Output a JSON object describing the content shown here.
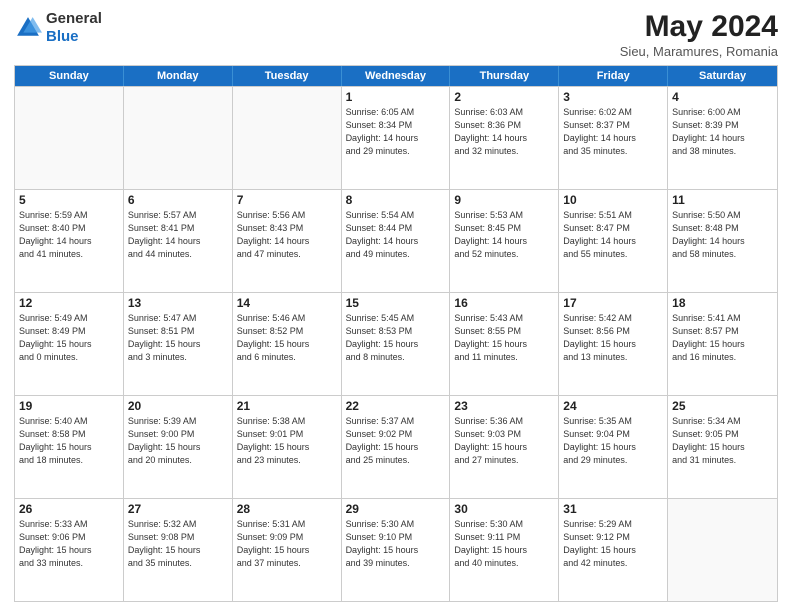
{
  "header": {
    "logo_general": "General",
    "logo_blue": "Blue",
    "title": "May 2024",
    "subtitle": "Sieu, Maramures, Romania"
  },
  "days_of_week": [
    "Sunday",
    "Monday",
    "Tuesday",
    "Wednesday",
    "Thursday",
    "Friday",
    "Saturday"
  ],
  "weeks": [
    [
      {
        "day": "",
        "info": "",
        "empty": true
      },
      {
        "day": "",
        "info": "",
        "empty": true
      },
      {
        "day": "",
        "info": "",
        "empty": true
      },
      {
        "day": "1",
        "info": "Sunrise: 6:05 AM\nSunset: 8:34 PM\nDaylight: 14 hours\nand 29 minutes.",
        "empty": false
      },
      {
        "day": "2",
        "info": "Sunrise: 6:03 AM\nSunset: 8:36 PM\nDaylight: 14 hours\nand 32 minutes.",
        "empty": false
      },
      {
        "day": "3",
        "info": "Sunrise: 6:02 AM\nSunset: 8:37 PM\nDaylight: 14 hours\nand 35 minutes.",
        "empty": false
      },
      {
        "day": "4",
        "info": "Sunrise: 6:00 AM\nSunset: 8:39 PM\nDaylight: 14 hours\nand 38 minutes.",
        "empty": false
      }
    ],
    [
      {
        "day": "5",
        "info": "Sunrise: 5:59 AM\nSunset: 8:40 PM\nDaylight: 14 hours\nand 41 minutes.",
        "empty": false
      },
      {
        "day": "6",
        "info": "Sunrise: 5:57 AM\nSunset: 8:41 PM\nDaylight: 14 hours\nand 44 minutes.",
        "empty": false
      },
      {
        "day": "7",
        "info": "Sunrise: 5:56 AM\nSunset: 8:43 PM\nDaylight: 14 hours\nand 47 minutes.",
        "empty": false
      },
      {
        "day": "8",
        "info": "Sunrise: 5:54 AM\nSunset: 8:44 PM\nDaylight: 14 hours\nand 49 minutes.",
        "empty": false
      },
      {
        "day": "9",
        "info": "Sunrise: 5:53 AM\nSunset: 8:45 PM\nDaylight: 14 hours\nand 52 minutes.",
        "empty": false
      },
      {
        "day": "10",
        "info": "Sunrise: 5:51 AM\nSunset: 8:47 PM\nDaylight: 14 hours\nand 55 minutes.",
        "empty": false
      },
      {
        "day": "11",
        "info": "Sunrise: 5:50 AM\nSunset: 8:48 PM\nDaylight: 14 hours\nand 58 minutes.",
        "empty": false
      }
    ],
    [
      {
        "day": "12",
        "info": "Sunrise: 5:49 AM\nSunset: 8:49 PM\nDaylight: 15 hours\nand 0 minutes.",
        "empty": false
      },
      {
        "day": "13",
        "info": "Sunrise: 5:47 AM\nSunset: 8:51 PM\nDaylight: 15 hours\nand 3 minutes.",
        "empty": false
      },
      {
        "day": "14",
        "info": "Sunrise: 5:46 AM\nSunset: 8:52 PM\nDaylight: 15 hours\nand 6 minutes.",
        "empty": false
      },
      {
        "day": "15",
        "info": "Sunrise: 5:45 AM\nSunset: 8:53 PM\nDaylight: 15 hours\nand 8 minutes.",
        "empty": false
      },
      {
        "day": "16",
        "info": "Sunrise: 5:43 AM\nSunset: 8:55 PM\nDaylight: 15 hours\nand 11 minutes.",
        "empty": false
      },
      {
        "day": "17",
        "info": "Sunrise: 5:42 AM\nSunset: 8:56 PM\nDaylight: 15 hours\nand 13 minutes.",
        "empty": false
      },
      {
        "day": "18",
        "info": "Sunrise: 5:41 AM\nSunset: 8:57 PM\nDaylight: 15 hours\nand 16 minutes.",
        "empty": false
      }
    ],
    [
      {
        "day": "19",
        "info": "Sunrise: 5:40 AM\nSunset: 8:58 PM\nDaylight: 15 hours\nand 18 minutes.",
        "empty": false
      },
      {
        "day": "20",
        "info": "Sunrise: 5:39 AM\nSunset: 9:00 PM\nDaylight: 15 hours\nand 20 minutes.",
        "empty": false
      },
      {
        "day": "21",
        "info": "Sunrise: 5:38 AM\nSunset: 9:01 PM\nDaylight: 15 hours\nand 23 minutes.",
        "empty": false
      },
      {
        "day": "22",
        "info": "Sunrise: 5:37 AM\nSunset: 9:02 PM\nDaylight: 15 hours\nand 25 minutes.",
        "empty": false
      },
      {
        "day": "23",
        "info": "Sunrise: 5:36 AM\nSunset: 9:03 PM\nDaylight: 15 hours\nand 27 minutes.",
        "empty": false
      },
      {
        "day": "24",
        "info": "Sunrise: 5:35 AM\nSunset: 9:04 PM\nDaylight: 15 hours\nand 29 minutes.",
        "empty": false
      },
      {
        "day": "25",
        "info": "Sunrise: 5:34 AM\nSunset: 9:05 PM\nDaylight: 15 hours\nand 31 minutes.",
        "empty": false
      }
    ],
    [
      {
        "day": "26",
        "info": "Sunrise: 5:33 AM\nSunset: 9:06 PM\nDaylight: 15 hours\nand 33 minutes.",
        "empty": false
      },
      {
        "day": "27",
        "info": "Sunrise: 5:32 AM\nSunset: 9:08 PM\nDaylight: 15 hours\nand 35 minutes.",
        "empty": false
      },
      {
        "day": "28",
        "info": "Sunrise: 5:31 AM\nSunset: 9:09 PM\nDaylight: 15 hours\nand 37 minutes.",
        "empty": false
      },
      {
        "day": "29",
        "info": "Sunrise: 5:30 AM\nSunset: 9:10 PM\nDaylight: 15 hours\nand 39 minutes.",
        "empty": false
      },
      {
        "day": "30",
        "info": "Sunrise: 5:30 AM\nSunset: 9:11 PM\nDaylight: 15 hours\nand 40 minutes.",
        "empty": false
      },
      {
        "day": "31",
        "info": "Sunrise: 5:29 AM\nSunset: 9:12 PM\nDaylight: 15 hours\nand 42 minutes.",
        "empty": false
      },
      {
        "day": "",
        "info": "",
        "empty": true
      }
    ]
  ]
}
